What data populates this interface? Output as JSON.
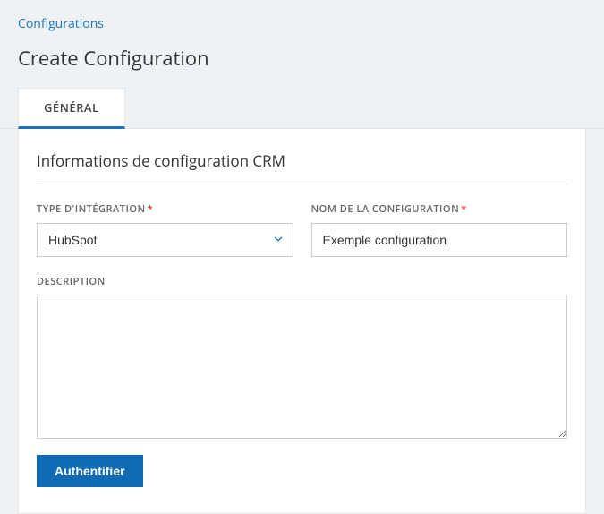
{
  "breadcrumb": {
    "link_label": "Configurations"
  },
  "page_title": "Create Configuration",
  "tabs": [
    {
      "label": "GÉNÉRAL",
      "active": true
    }
  ],
  "section": {
    "title": "Informations de configuration CRM",
    "fields": {
      "integration_type": {
        "label": "TYPE D'INTÉGRATION",
        "required_marker": "*",
        "value": "HubSpot"
      },
      "config_name": {
        "label": "NOM DE LA CONFIGURATION",
        "required_marker": "*",
        "value": "Exemple configuration"
      },
      "description": {
        "label": "DESCRIPTION",
        "value": ""
      }
    },
    "auth_button": "Authentifier"
  }
}
